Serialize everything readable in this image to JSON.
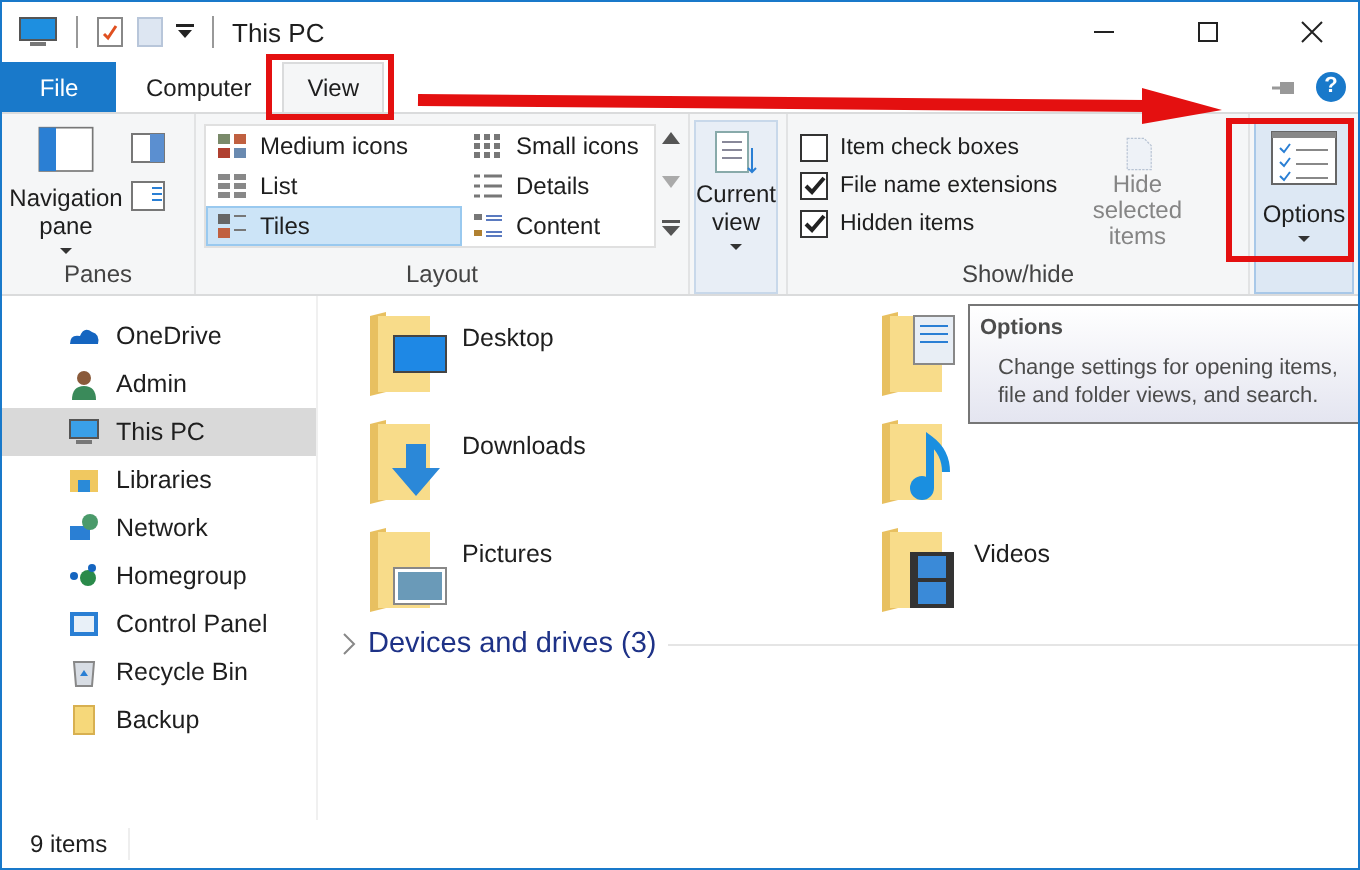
{
  "window": {
    "title": "This PC"
  },
  "ribbon_tabs": [
    {
      "label": "File",
      "kind": "file",
      "selected": false
    },
    {
      "label": "Computer",
      "kind": "tab",
      "selected": false
    },
    {
      "label": "View",
      "kind": "tab",
      "selected": true
    }
  ],
  "help_glyph": "?",
  "panes": {
    "label": "Panes",
    "navigation_pane": "Navigation pane"
  },
  "layout": {
    "label": "Layout",
    "options": [
      {
        "label": "Medium icons",
        "kind": "medium",
        "selected": false
      },
      {
        "label": "Small icons",
        "kind": "small",
        "selected": false
      },
      {
        "label": "List",
        "kind": "list",
        "selected": false
      },
      {
        "label": "Details",
        "kind": "details",
        "selected": false
      },
      {
        "label": "Tiles",
        "kind": "tiles",
        "selected": true
      },
      {
        "label": "Content",
        "kind": "content",
        "selected": false
      }
    ]
  },
  "current_view": {
    "label": "Current view"
  },
  "show_hide": {
    "label": "Show/hide",
    "checkboxes": [
      {
        "label": "Item check boxes",
        "checked": false
      },
      {
        "label": "File name extensions",
        "checked": true
      },
      {
        "label": "Hidden items",
        "checked": true
      }
    ],
    "hide_selected": {
      "label": "Hide selected items",
      "disabled": true
    }
  },
  "options_button": {
    "label": "Options"
  },
  "tooltip": {
    "title": "Options",
    "text": "Change settings for opening items, file and folder views, and search."
  },
  "sidebar": {
    "items": [
      {
        "label": "OneDrive",
        "kind": "cloud",
        "selected": false
      },
      {
        "label": "Admin",
        "kind": "user",
        "selected": false
      },
      {
        "label": "This PC",
        "kind": "pc",
        "selected": true
      },
      {
        "label": "Libraries",
        "kind": "library",
        "selected": false
      },
      {
        "label": "Network",
        "kind": "network",
        "selected": false
      },
      {
        "label": "Homegroup",
        "kind": "homegroup",
        "selected": false
      },
      {
        "label": "Control Panel",
        "kind": "control",
        "selected": false
      },
      {
        "label": "Recycle Bin",
        "kind": "bin",
        "selected": false
      },
      {
        "label": "Backup",
        "kind": "folder",
        "selected": false
      }
    ]
  },
  "folders": [
    {
      "label": "Desktop",
      "kind": "desktop"
    },
    {
      "kind": "documents"
    },
    {
      "label": "Downloads",
      "kind": "downloads"
    },
    {
      "kind": "music"
    },
    {
      "label": "Pictures",
      "kind": "pictures"
    },
    {
      "label": "Videos",
      "kind": "videos"
    }
  ],
  "section": {
    "label": "Devices and drives (3)",
    "expanded": false
  },
  "status_bar": {
    "count": "9 items"
  }
}
